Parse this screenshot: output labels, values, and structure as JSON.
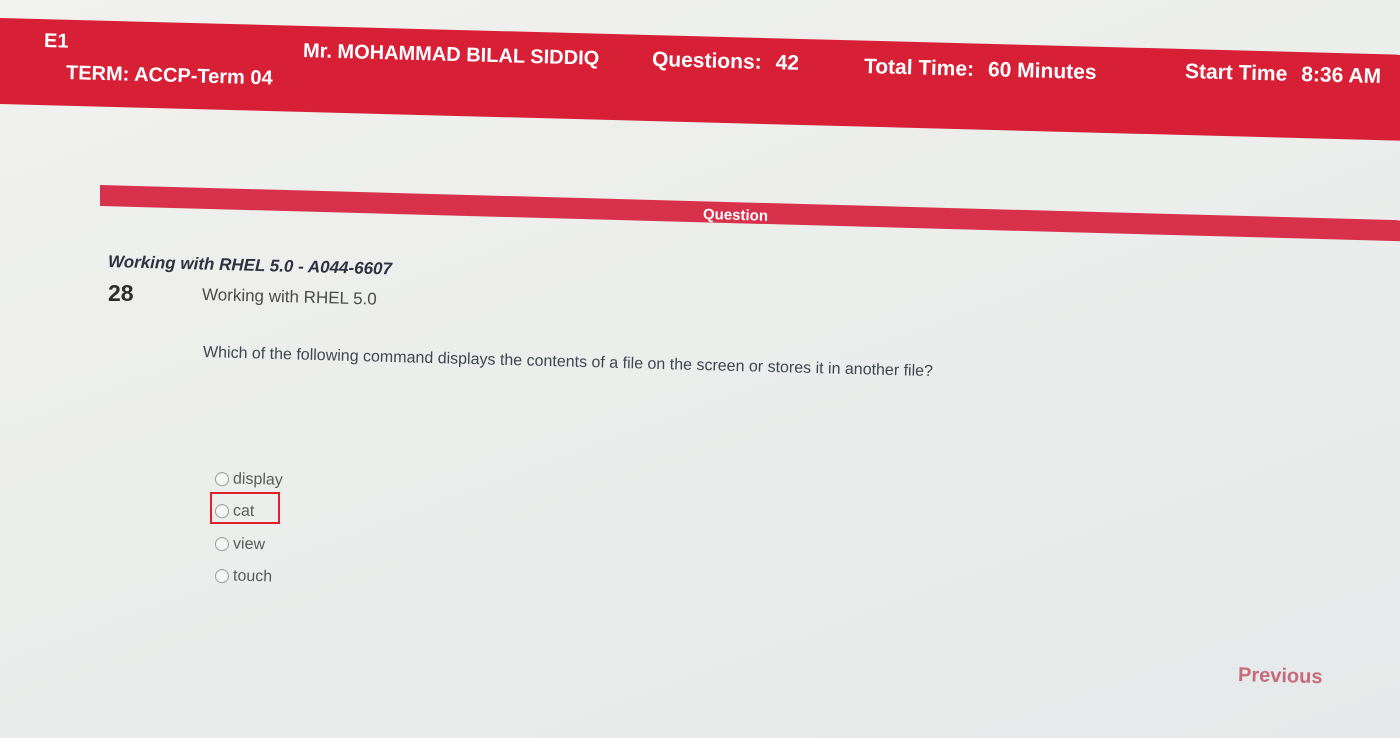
{
  "header": {
    "code": "E1",
    "term": "TERM: ACCP-Term 04",
    "student_name": "Mr. MOHAMMAD BILAL SIDDIQ",
    "questions_label": "Questions:",
    "questions_value": "42",
    "total_time_label": "Total Time:",
    "total_time_value": "60 Minutes",
    "start_time_label": "Start Time",
    "start_time_value": "8:36 AM"
  },
  "question_bar_label": "Question",
  "question": {
    "subject_title": "Working with RHEL 5.0 - A044-6607",
    "number": "28",
    "topic": "Working with RHEL 5.0",
    "text": "Which of the following command displays the contents of a file on the screen or stores it in another file?",
    "options": [
      {
        "label": "display"
      },
      {
        "label": "cat"
      },
      {
        "label": "view"
      },
      {
        "label": "touch"
      }
    ],
    "highlighted_option": "cat"
  },
  "navigation": {
    "previous_label": "Previous"
  },
  "colors": {
    "header_red": "#d71f36",
    "highlight_border": "#e0202a",
    "previous_link": "#c66b7b"
  }
}
